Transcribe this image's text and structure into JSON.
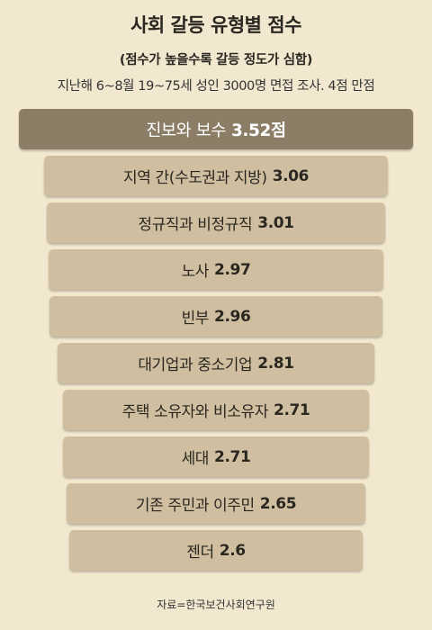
{
  "title": "사회 갈등 유형별 점수",
  "subtitle": "(점수가 높을수록 갈등 정도가 심함)",
  "note": "지난해 6~8월 19~75세 성인 3000명 면접 조사. 4점 만점",
  "source": "자료=한국보건사회연구원",
  "colors": {
    "background": "#f2e8cf",
    "bar": "#cfbfa0",
    "highlight_bar": "#8b7d66"
  },
  "chart_data": {
    "type": "bar",
    "orientation": "horizontal-centered",
    "value_suffix": "점",
    "max_score": 4,
    "categories": [
      "진보와 보수",
      "지역 간(수도권과 지방)",
      "정규직과 비정규직",
      "노사",
      "빈부",
      "대기업과 중소기업",
      "주택 소유자와 비소유자",
      "세대",
      "기존 주민과 이주민",
      "젠더"
    ],
    "values": [
      3.52,
      3.06,
      3.01,
      2.97,
      2.96,
      2.81,
      2.71,
      2.71,
      2.65,
      2.6
    ],
    "value_labels": [
      "3.52점",
      "3.06",
      "3.01",
      "2.97",
      "2.96",
      "2.81",
      "2.71",
      "2.71",
      "2.65",
      "2.6"
    ]
  }
}
